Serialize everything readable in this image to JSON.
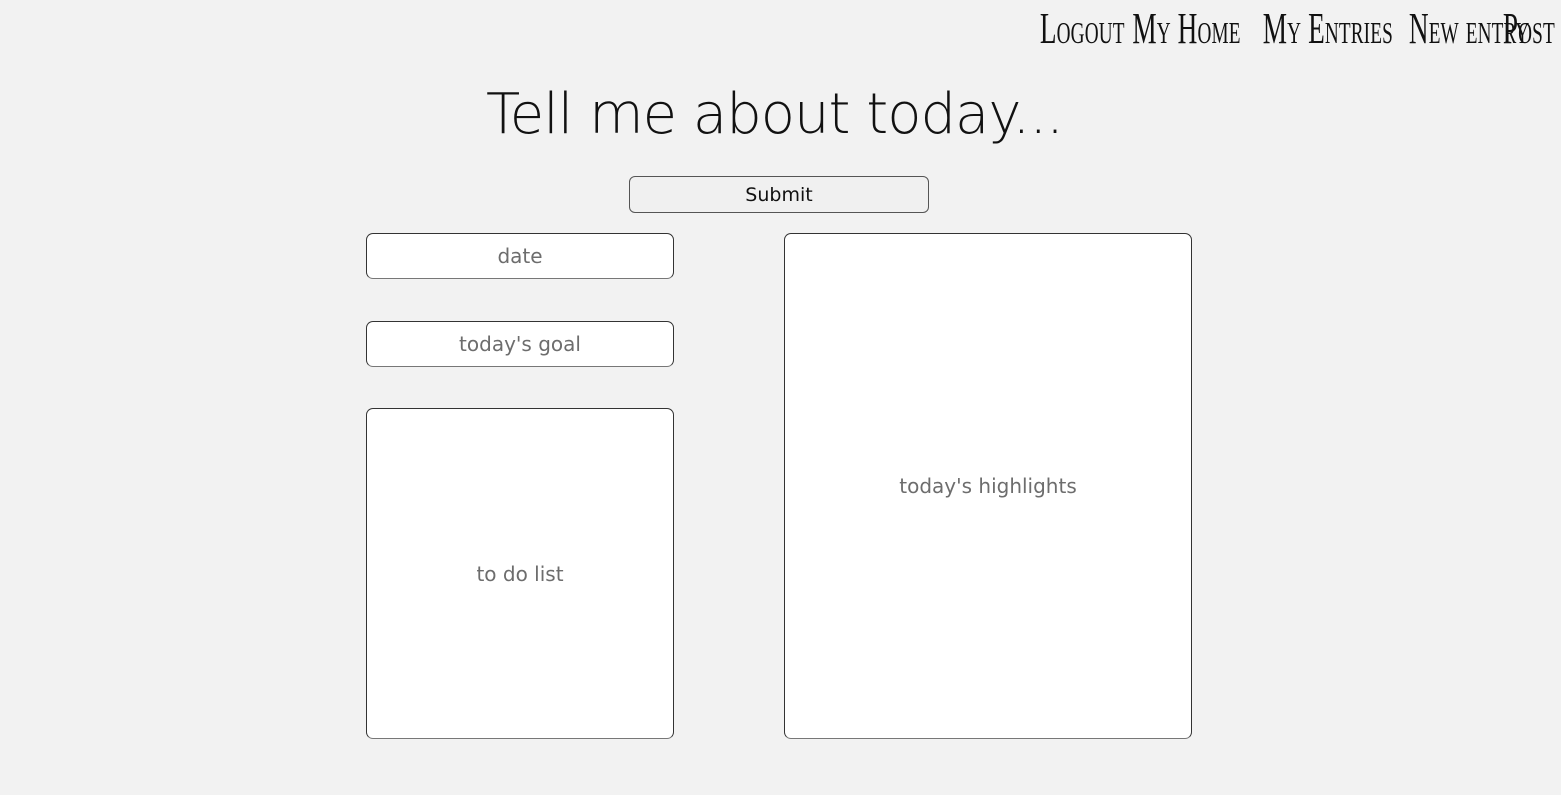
{
  "nav": {
    "items": [
      {
        "label": "Logout"
      },
      {
        "label": "My Home"
      },
      {
        "label": "My Entries"
      },
      {
        "label": "New entry"
      },
      {
        "label": "Post"
      }
    ]
  },
  "page": {
    "title": "Tell me about today..."
  },
  "form": {
    "submit_label": "Submit",
    "date_placeholder": "date",
    "goal_placeholder": "today's goal",
    "todo_placeholder": "to do list",
    "highlights_placeholder": "today's highlights"
  }
}
